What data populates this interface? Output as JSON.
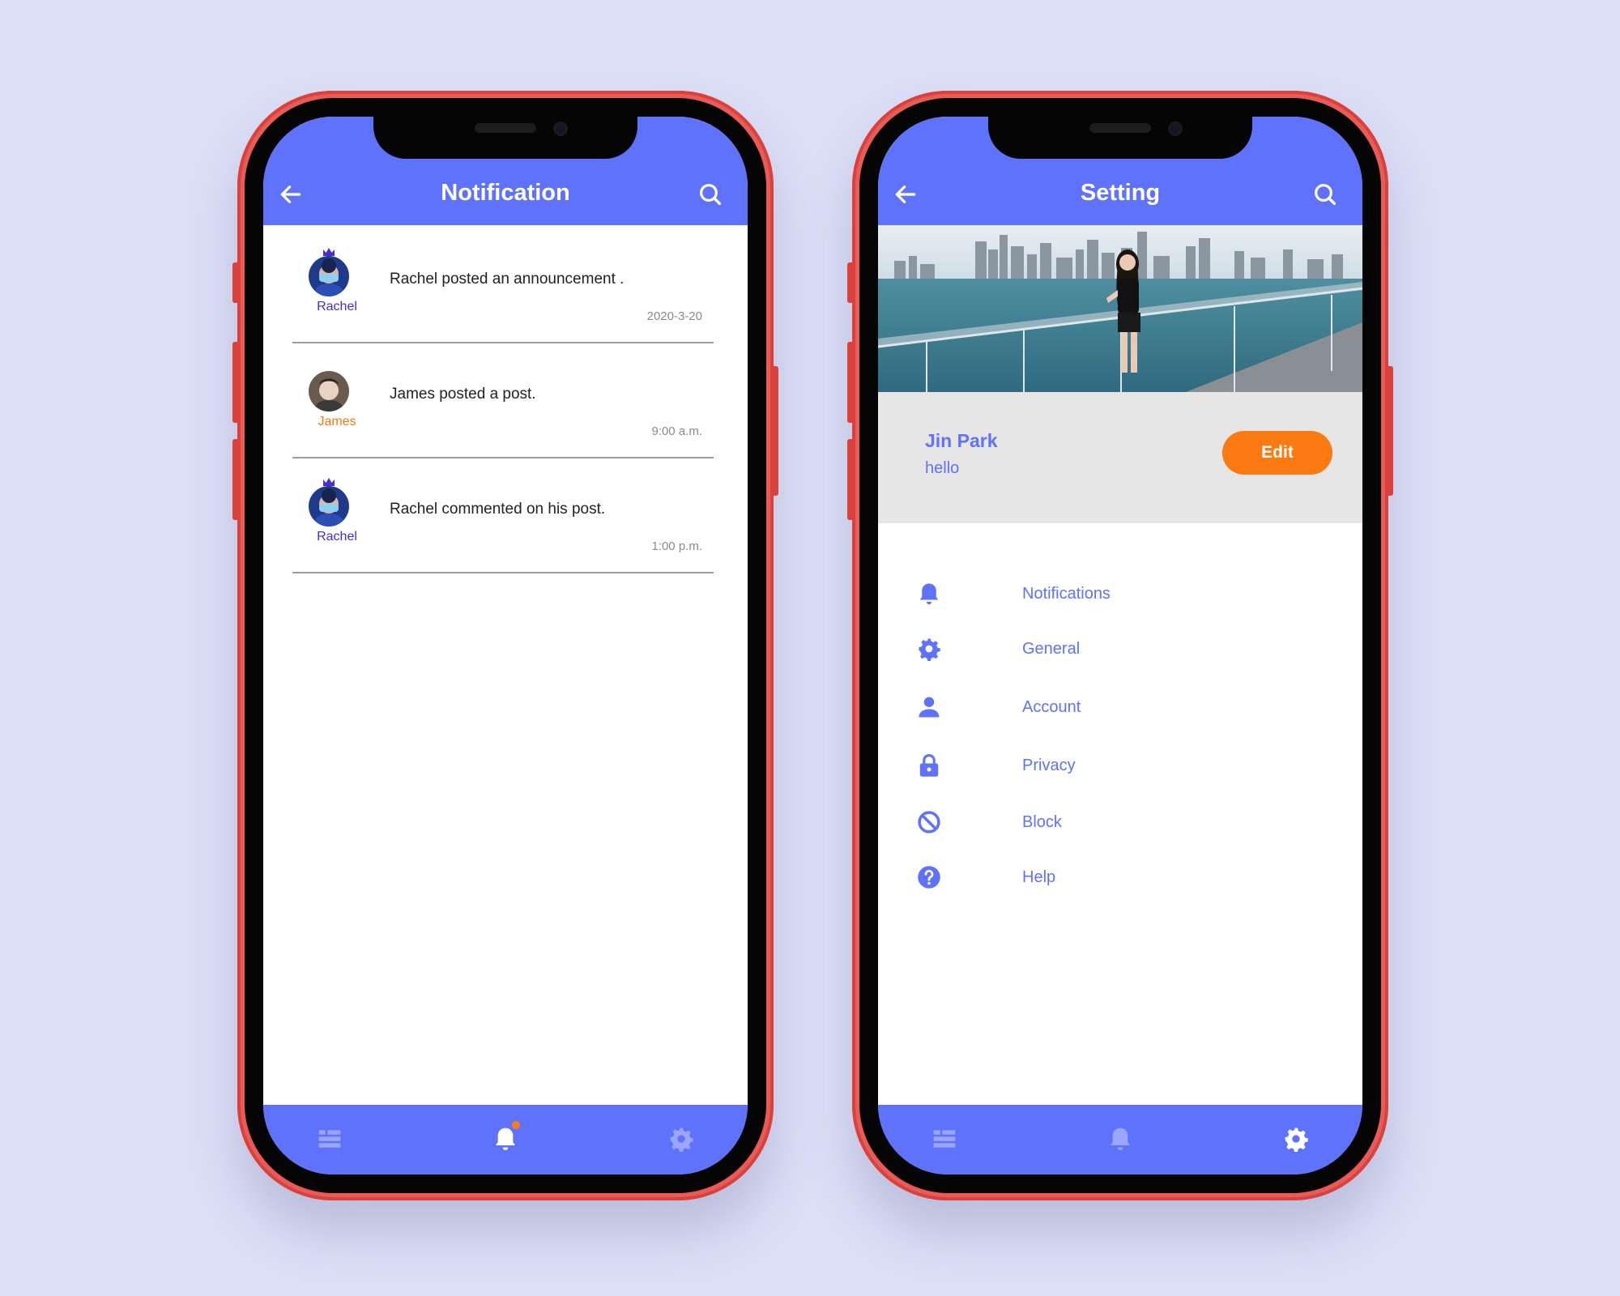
{
  "colors": {
    "accent": "#5e72fb",
    "orange": "#fb7a12",
    "frame": "#ea5b57",
    "background": "#dcdff7"
  },
  "notification_screen": {
    "title": "Notification",
    "back_icon": "arrow-left-icon",
    "search_icon": "search-icon",
    "items": [
      {
        "name": "Rachel",
        "name_color": "#4b2bcf",
        "message": "Rachel posted an announcement .",
        "time": "2020-3-20"
      },
      {
        "name": "James",
        "name_color": "#f47a10",
        "message": "James posted a post.",
        "time": "9:00 a.m."
      },
      {
        "name": "Rachel",
        "name_color": "#4b2bcf",
        "message": "Rachel commented on his post.",
        "time": "1:00 p.m."
      }
    ],
    "tabs": [
      {
        "icon": "list-icon",
        "active": false
      },
      {
        "icon": "bell-icon",
        "active": true,
        "badge": true
      },
      {
        "icon": "gear-icon",
        "active": false
      }
    ]
  },
  "settings_screen": {
    "title": "Setting",
    "back_icon": "arrow-left-icon",
    "search_icon": "search-icon",
    "profile": {
      "name": "Jin Park",
      "status": "hello",
      "edit_label": "Edit"
    },
    "menu": [
      {
        "label": "Notifications",
        "icon": "bell-icon"
      },
      {
        "label": "General",
        "icon": "gear-icon"
      },
      {
        "label": "Account",
        "icon": "person-icon"
      },
      {
        "label": "Privacy",
        "icon": "lock-icon"
      },
      {
        "label": "Block",
        "icon": "block-icon"
      },
      {
        "label": "Help",
        "icon": "help-icon"
      }
    ],
    "tabs": [
      {
        "icon": "list-icon",
        "active": false
      },
      {
        "icon": "bell-icon",
        "active": false
      },
      {
        "icon": "gear-icon",
        "active": true
      }
    ]
  }
}
